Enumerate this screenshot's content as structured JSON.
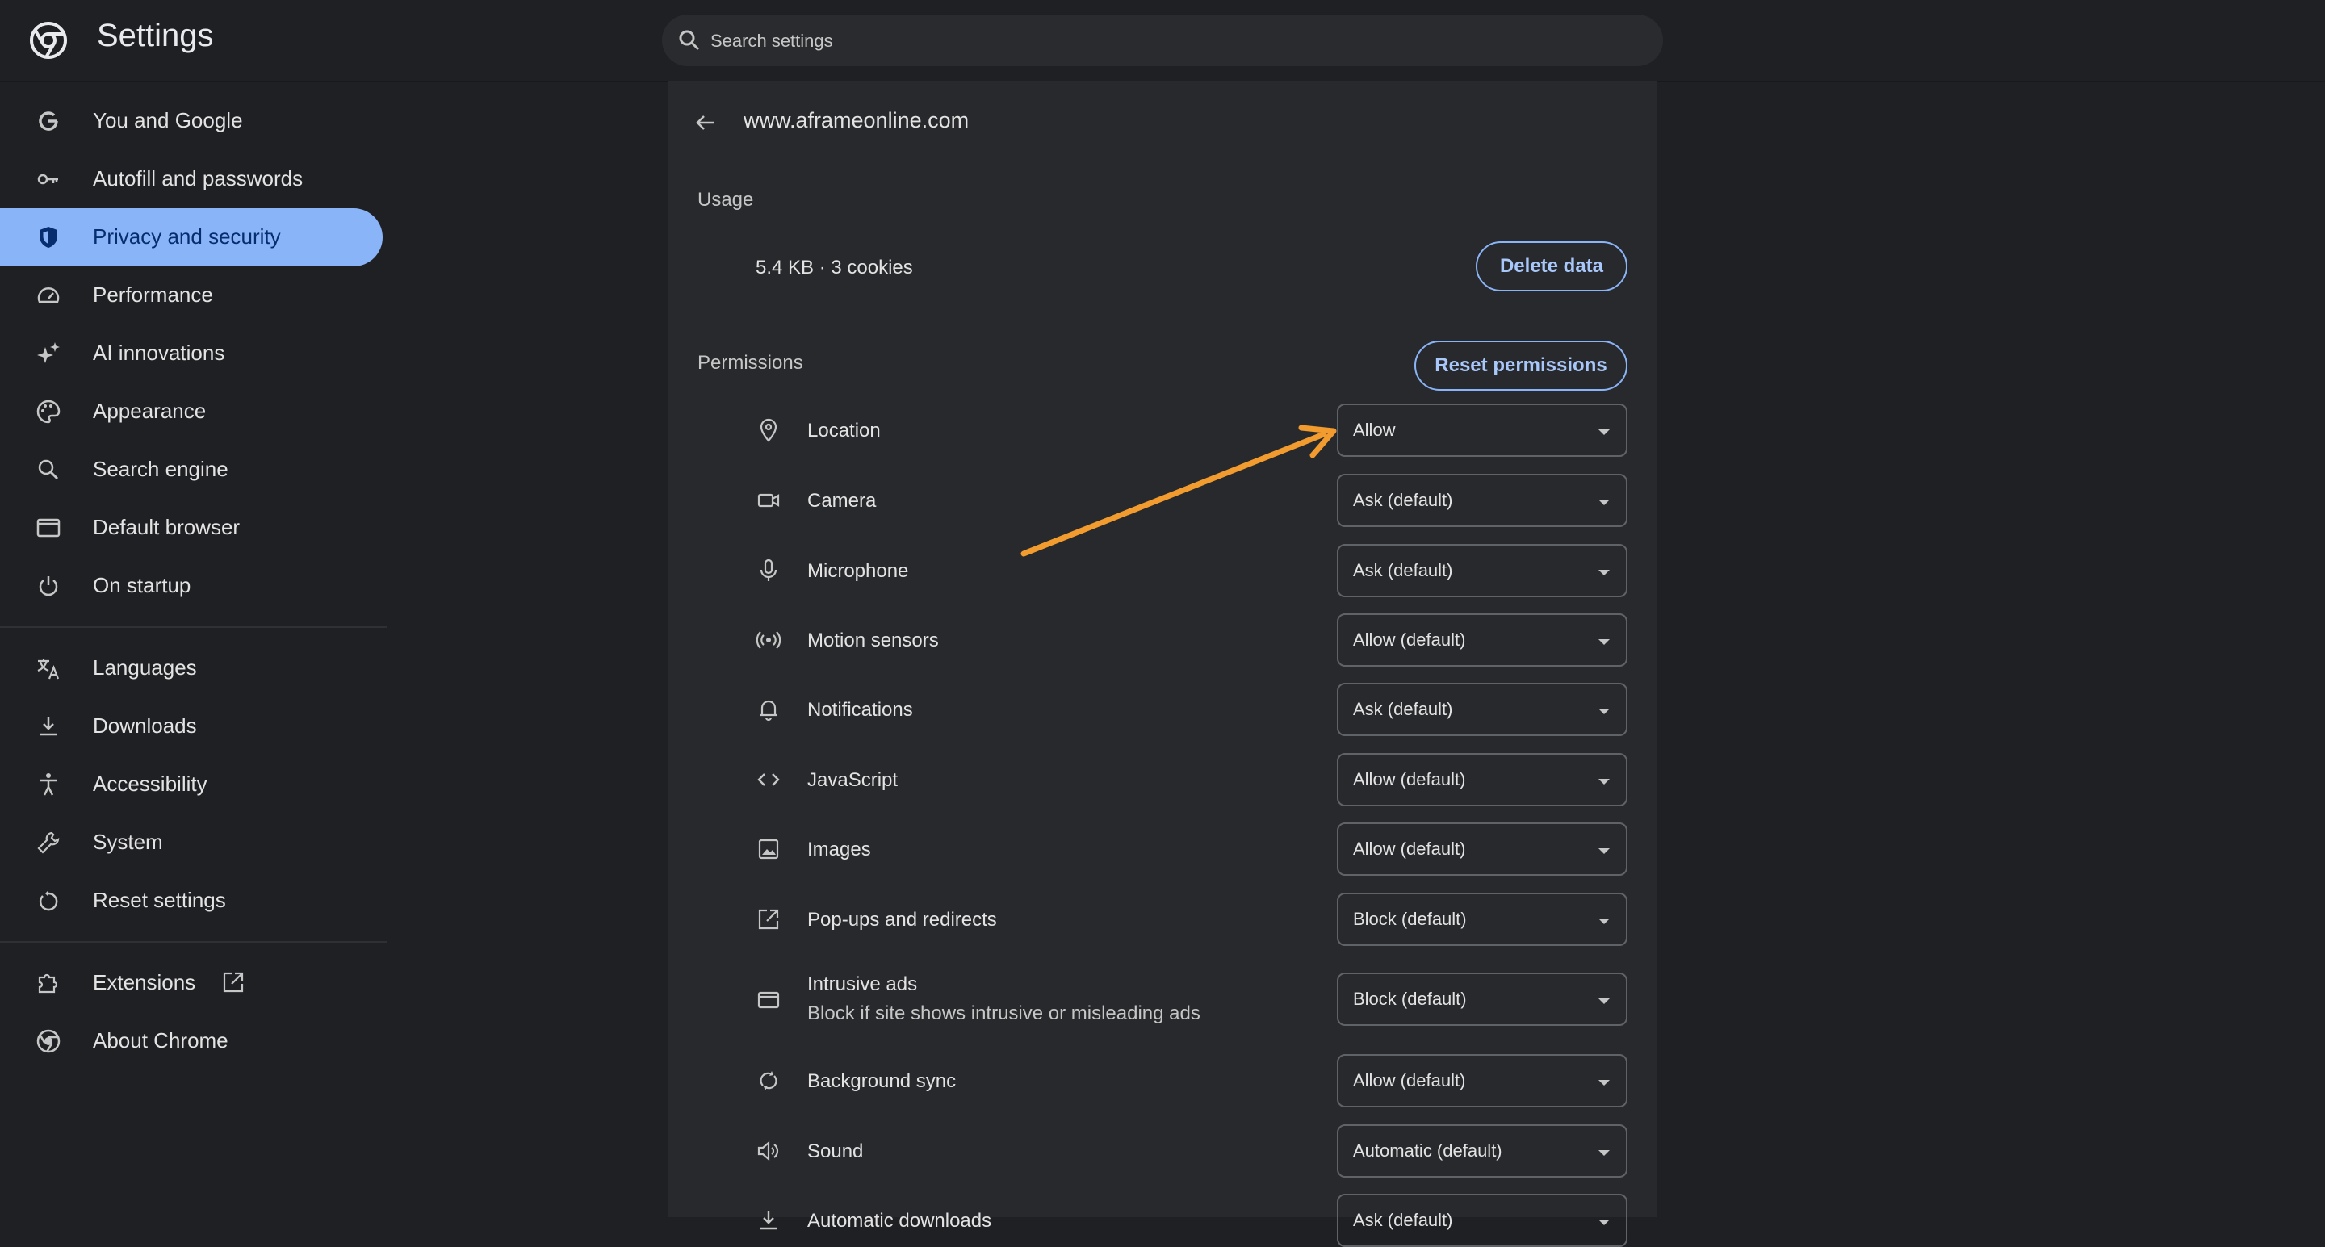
{
  "header": {
    "title": "Settings",
    "search_placeholder": "Search settings"
  },
  "sidebar": {
    "items": [
      {
        "label": "You and Google",
        "icon": "google-icon"
      },
      {
        "label": "Autofill and passwords",
        "icon": "key-icon"
      },
      {
        "label": "Privacy and security",
        "icon": "shield-icon",
        "active": true
      },
      {
        "label": "Performance",
        "icon": "speedometer-icon"
      },
      {
        "label": "AI innovations",
        "icon": "sparkle-icon"
      },
      {
        "label": "Appearance",
        "icon": "palette-icon"
      },
      {
        "label": "Search engine",
        "icon": "search-icon"
      },
      {
        "label": "Default browser",
        "icon": "browser-window-icon"
      },
      {
        "label": "On startup",
        "icon": "power-icon"
      },
      {
        "label": "Languages",
        "icon": "translate-icon"
      },
      {
        "label": "Downloads",
        "icon": "download-icon"
      },
      {
        "label": "Accessibility",
        "icon": "accessibility-icon"
      },
      {
        "label": "System",
        "icon": "wrench-icon"
      },
      {
        "label": "Reset settings",
        "icon": "reset-icon"
      },
      {
        "label": "Extensions",
        "icon": "puzzle-icon"
      },
      {
        "label": "About Chrome",
        "icon": "chrome-icon"
      }
    ]
  },
  "site": {
    "title": "www.aframeonline.com",
    "usage_heading": "Usage",
    "usage_text": "5.4 KB · 3 cookies",
    "delete_label": "Delete data",
    "permissions_heading": "Permissions",
    "reset_label": "Reset permissions"
  },
  "permissions": [
    {
      "name": "Location",
      "value": "Allow",
      "icon": "location-pin-icon"
    },
    {
      "name": "Camera",
      "value": "Ask (default)",
      "icon": "camera-icon"
    },
    {
      "name": "Microphone",
      "value": "Ask (default)",
      "icon": "microphone-icon"
    },
    {
      "name": "Motion sensors",
      "value": "Allow (default)",
      "icon": "motion-sensor-icon"
    },
    {
      "name": "Notifications",
      "value": "Ask (default)",
      "icon": "bell-icon"
    },
    {
      "name": "JavaScript",
      "value": "Allow (default)",
      "icon": "code-icon"
    },
    {
      "name": "Images",
      "value": "Allow (default)",
      "icon": "image-icon"
    },
    {
      "name": "Pop-ups and redirects",
      "value": "Block (default)",
      "icon": "open-external-icon"
    },
    {
      "name": "Intrusive ads",
      "sub": "Block if site shows intrusive or misleading ads",
      "value": "Block (default)",
      "icon": "ad-window-icon"
    },
    {
      "name": "Background sync",
      "value": "Allow (default)",
      "icon": "sync-icon"
    },
    {
      "name": "Sound",
      "value": "Automatic (default)",
      "icon": "speaker-icon"
    },
    {
      "name": "Automatic downloads",
      "value": "Ask (default)",
      "icon": "download-icon"
    }
  ],
  "colors": {
    "accent": "#8ab4f8",
    "annotation_arrow": "#f29b2e"
  }
}
